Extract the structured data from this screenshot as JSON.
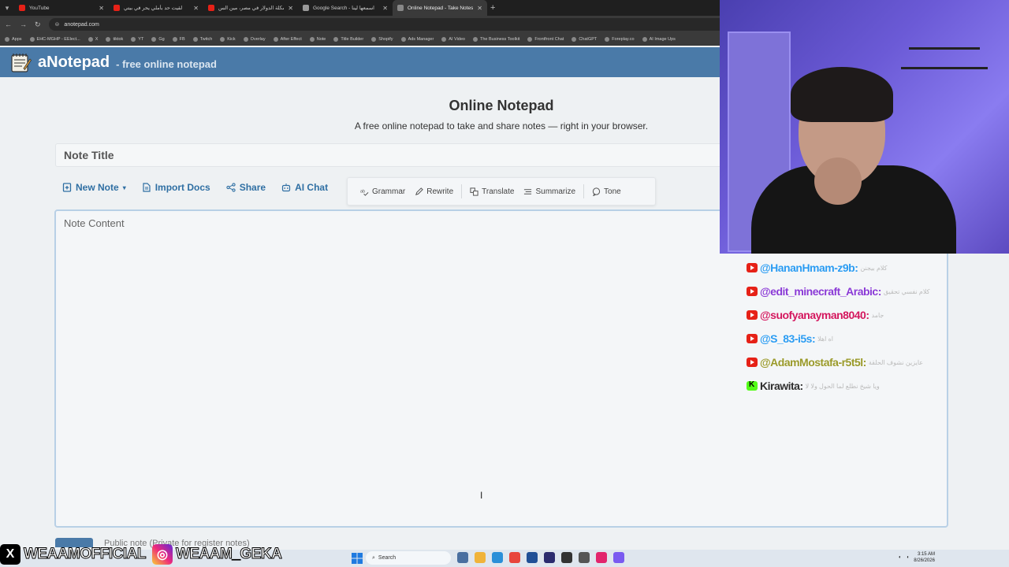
{
  "browser": {
    "tabs": [
      {
        "title": "YouTube",
        "color": "#e62117"
      },
      {
        "title": "لقيت حد بأملي يحر في بيتي",
        "color": "#e62117"
      },
      {
        "title": "مشكلة الدولار في مصر، مين الس",
        "color": "#e62117"
      },
      {
        "title": "Google Search - اسمعها لينا",
        "color": "#999999"
      },
      {
        "title": "Online Notepad - Take Notes",
        "color": "#888888"
      }
    ],
    "url": "anotepad.com",
    "bookmarks": [
      "Apps",
      "EHC-MGHP - EElect...",
      "X",
      "tiktok",
      "YT",
      "Gg",
      "FB",
      "Twitch",
      "Kick",
      "Overlay",
      "After Effect",
      "Note",
      "Title Builder",
      "Shopify",
      "Ads Manager",
      "AI Video",
      "The Business Toolkit",
      "Frontfront Chat",
      "ChatGPT",
      "Foreplay.co",
      "AI Image Ups"
    ]
  },
  "site": {
    "brand": "aNotepad",
    "tagline": "- free online notepad"
  },
  "hero": {
    "title": "Online Notepad",
    "subtitle": "A free online notepad to take and share notes — right in your browser."
  },
  "editor": {
    "title_placeholder": "Note Title",
    "content_placeholder": "Note Content",
    "public_option": "Public note (Private for register notes)"
  },
  "toolbar": {
    "new_note": "New Note",
    "import_docs": "Import Docs",
    "share": "Share",
    "ai_chat": "AI Chat"
  },
  "ai_tools": {
    "grammar": "Grammar",
    "rewrite": "Rewrite",
    "translate": "Translate",
    "summarize": "Summarize",
    "tone": "Tone"
  },
  "chat": [
    {
      "user": "@HananHmam-z9b:",
      "message": "كلام بيجنن",
      "color": "#2b9cf2",
      "platform": "youtube"
    },
    {
      "user": "@edit_minecraft_Arabic:",
      "message": "كلام نفسي تحقيق",
      "color": "#8a3ad6",
      "platform": "youtube"
    },
    {
      "user": "@suofyanayman8040:",
      "message": "جامد",
      "color": "#d3175e",
      "platform": "youtube"
    },
    {
      "user": "@S_83-i5s:",
      "message": "اه اهلا",
      "color": "#2b9cf2",
      "platform": "youtube"
    },
    {
      "user": "@AdamMostafa-r5t5l:",
      "message": "عايزين نشوف الحلقة",
      "color": "#9a9a2a",
      "platform": "youtube"
    },
    {
      "user": "Kirawita:",
      "message": "ويا شيخ نطلع لما الحول ولا لا",
      "color": "#2f2f2f",
      "platform": "kick"
    }
  ],
  "social": {
    "x_handle": "WEAAMOFFICIAL",
    "ig_handle": "WEAAM_GEKA"
  },
  "taskbar": {
    "search": "Search",
    "time": "3:15 AM",
    "date": "8/26/2026"
  }
}
